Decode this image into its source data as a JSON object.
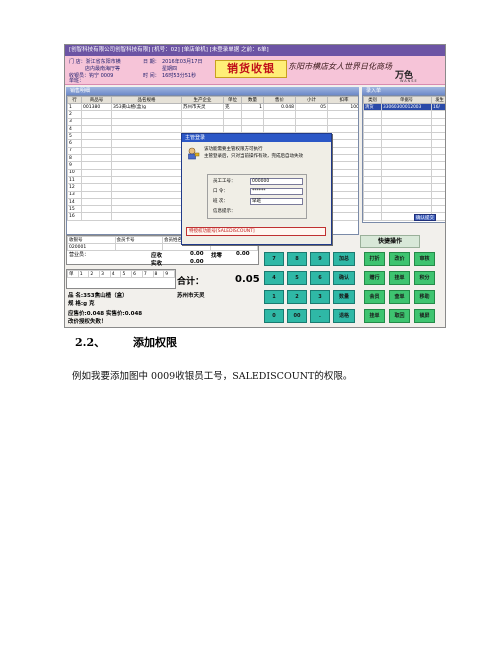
{
  "screenshot": {
    "titlebar": "[创智科技有限公司创智科技有限] [机号：02] [单店单机] [未登录单据 之前：6单]",
    "header": {
      "line1": "门 店：浙江省东阳市横",
      "line2": "店内最南海厅等",
      "date_label": "日 期：",
      "date_value": "2016年03月17日",
      "day_value": "星期四",
      "cashier_label": "收银员：",
      "cashier_value": "钩宁 0009",
      "time_label": "时  间：",
      "time_value": "16时53分51秒",
      "shift_label": "单班：",
      "system_title": "销货收银",
      "shop_name": "东阳市横店女人世界日化商场",
      "brand": "万色",
      "brand_sub": "WANSE"
    },
    "sales_panel": {
      "title": "销售明细",
      "columns": [
        "行",
        "商品号",
        "品名规格",
        "生产企业",
        "单位",
        "数量",
        "售价",
        "小计",
        "扣率"
      ],
      "rows": [
        [
          "1",
          "001380",
          "353黄山楂(盒)g",
          "苏州市天灵",
          "克",
          "1",
          "0.048",
          "05",
          "100"
        ],
        [
          "2",
          "",
          "",
          "",
          "",
          "",
          "",
          "",
          ""
        ],
        [
          "3",
          "",
          "",
          "",
          "",
          "",
          "",
          "",
          ""
        ],
        [
          "4",
          "",
          "",
          "",
          "",
          "",
          "",
          "",
          ""
        ],
        [
          "5",
          "",
          "",
          "",
          "",
          "",
          "",
          "",
          ""
        ],
        [
          "6",
          "",
          "",
          "",
          "",
          "",
          "",
          "",
          ""
        ],
        [
          "7",
          "",
          "",
          "",
          "",
          "",
          "",
          "",
          ""
        ],
        [
          "8",
          "",
          "",
          "",
          "",
          "",
          "",
          "",
          ""
        ],
        [
          "9",
          "",
          "",
          "",
          "",
          "",
          "",
          "",
          ""
        ],
        [
          "10",
          "",
          "",
          "",
          "",
          "",
          "",
          "",
          ""
        ],
        [
          "11",
          "",
          "",
          "",
          "",
          "",
          "",
          "",
          ""
        ],
        [
          "12",
          "",
          "",
          "",
          "",
          "",
          "",
          "",
          ""
        ],
        [
          "13",
          "",
          "",
          "",
          "",
          "",
          "",
          "",
          ""
        ],
        [
          "14",
          "",
          "",
          "",
          "",
          "",
          "",
          "",
          ""
        ],
        [
          "15",
          "",
          "",
          "",
          "",
          "",
          "",
          "",
          ""
        ],
        [
          "16",
          "",
          "",
          "",
          "",
          "",
          "",
          "",
          ""
        ]
      ]
    },
    "entry_panel": {
      "title": "录入单",
      "columns": [
        "类别",
        "单据号",
        "发生"
      ],
      "rows": [
        [
          "清货",
          "33060300012003",
          "16/"
        ]
      ],
      "query_button": "确认提交"
    },
    "dialog": {
      "title": "主管登录",
      "message1": "该功能需要主管权限方可执行",
      "message2": "主管登录后，只对当前操作有效，完成后自动失效",
      "fields": [
        {
          "label": "员工工号：",
          "value": "000000"
        },
        {
          "label": "口    令：",
          "value": "******"
        },
        {
          "label": "班    次：",
          "value": "早班"
        },
        {
          "label": "信息提示：",
          "value": ""
        }
      ],
      "auth_code": "特授权功能号[SALEDISCOUNT]"
    },
    "info": {
      "member_cols": [
        "收银号",
        "会员卡号",
        "会员姓名",
        "积分"
      ],
      "member_row": [
        "020001",
        "",
        "",
        ""
      ],
      "business_label": "营业员：",
      "due_label": "应收",
      "due_value": "0.00",
      "change_label": "找零",
      "change_value": "0.00",
      "paid_label": "实收",
      "paid_value": "0.00",
      "total_label": "合计：",
      "total_value": "0.05",
      "row_label": "单",
      "row_cells": [
        "1",
        "2",
        "3",
        "4",
        "5",
        "6",
        "7",
        "8",
        "9"
      ],
      "product_name": "品  名:353焦山楂（盒）",
      "producer": "苏州市天灵",
      "spec": "规  格:g    克",
      "amount_line": "应售价:0.048  实售价:0.048",
      "auth_fail": "改价授权失败！"
    },
    "keypad": {
      "keys": [
        "7",
        "8",
        "9",
        "加总",
        "4",
        "5",
        "6",
        "确认",
        "1",
        "2",
        "3",
        "数量",
        "0",
        "00",
        ".",
        "退格"
      ]
    },
    "quick": {
      "title": "快捷操作",
      "buttons": [
        "打折",
        "改价",
        "审核",
        "赠行",
        "挂单",
        "积分",
        "会员",
        "查单",
        "移助",
        "挂单",
        "取回",
        "锁屏"
      ]
    }
  },
  "doc": {
    "section_number": "2.2、",
    "section_title": "添加权限",
    "paragraph": "例如我要添加图中  0009收银员工号，SALEDISCOUNT的权限。"
  }
}
